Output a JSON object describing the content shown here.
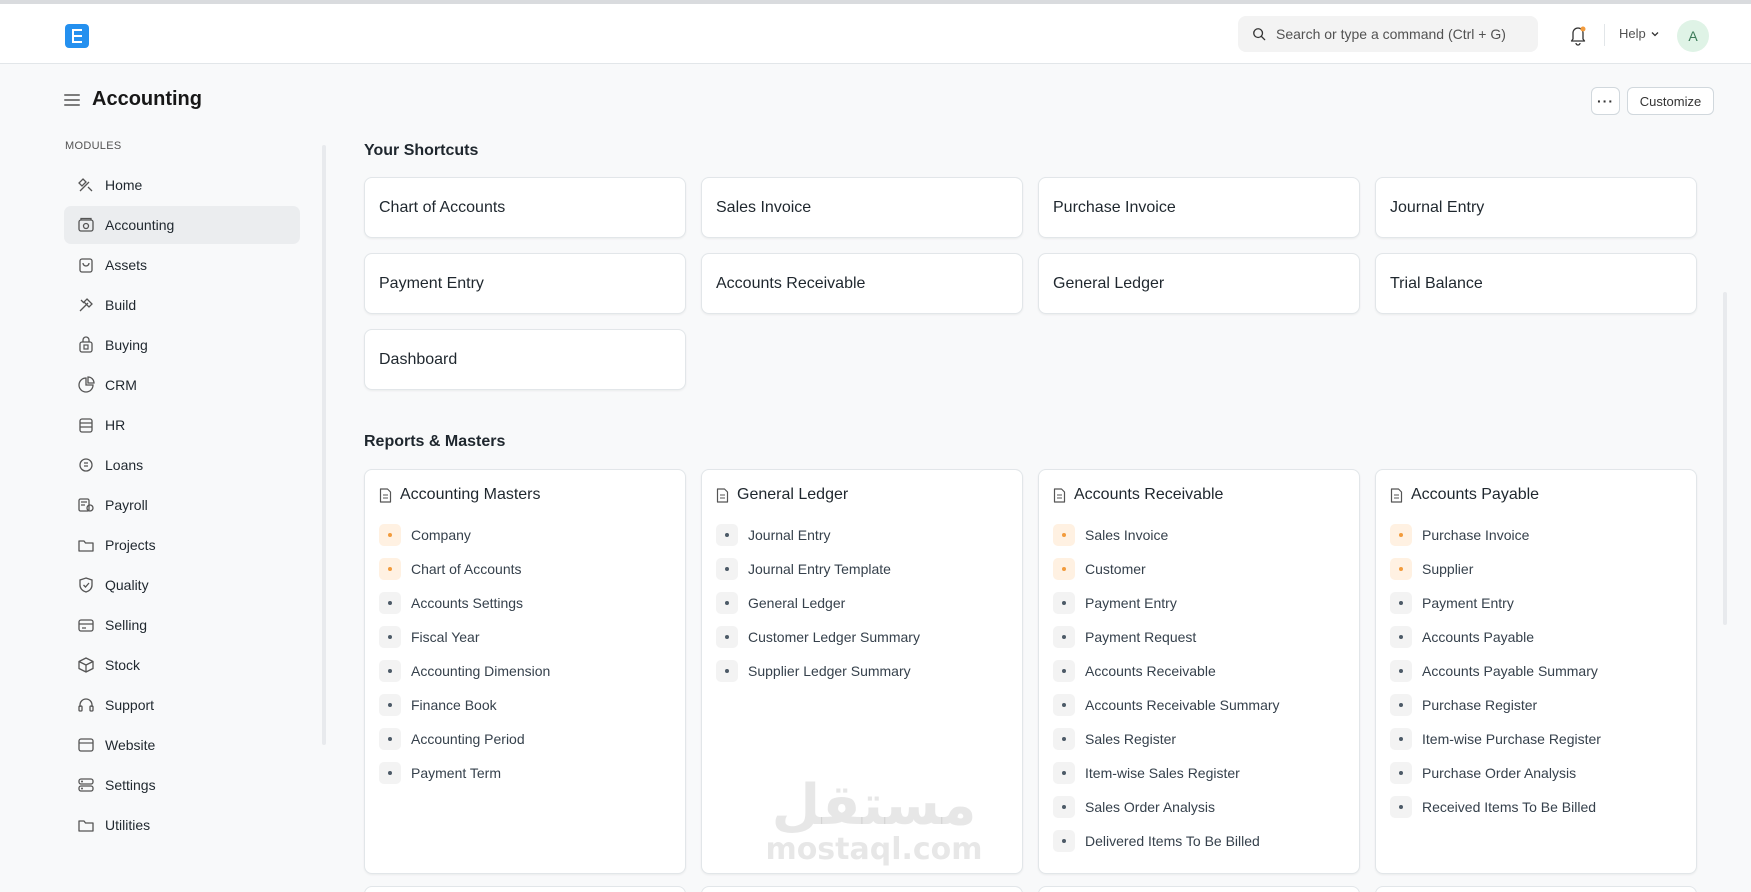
{
  "navbar": {
    "search_placeholder": "Search or type a command (Ctrl + G)",
    "help_label": "Help",
    "avatar_initial": "A"
  },
  "page": {
    "title": "Accounting",
    "more_label": "···",
    "customize_label": "Customize"
  },
  "sidebar": {
    "section_label": "MODULES",
    "items": [
      {
        "label": "Home",
        "icon": "home-icon"
      },
      {
        "label": "Accounting",
        "icon": "accounting-icon",
        "active": true
      },
      {
        "label": "Assets",
        "icon": "assets-icon"
      },
      {
        "label": "Build",
        "icon": "build-icon"
      },
      {
        "label": "Buying",
        "icon": "buying-icon"
      },
      {
        "label": "CRM",
        "icon": "crm-icon"
      },
      {
        "label": "HR",
        "icon": "hr-icon"
      },
      {
        "label": "Loans",
        "icon": "loans-icon"
      },
      {
        "label": "Payroll",
        "icon": "payroll-icon"
      },
      {
        "label": "Projects",
        "icon": "projects-icon"
      },
      {
        "label": "Quality",
        "icon": "quality-icon"
      },
      {
        "label": "Selling",
        "icon": "selling-icon"
      },
      {
        "label": "Stock",
        "icon": "stock-icon"
      },
      {
        "label": "Support",
        "icon": "support-icon"
      },
      {
        "label": "Website",
        "icon": "website-icon"
      },
      {
        "label": "Settings",
        "icon": "settings-icon"
      },
      {
        "label": "Utilities",
        "icon": "utilities-icon"
      }
    ]
  },
  "shortcuts": {
    "title": "Your Shortcuts",
    "items": [
      "Chart of Accounts",
      "Sales Invoice",
      "Purchase Invoice",
      "Journal Entry",
      "Payment Entry",
      "Accounts Receivable",
      "General Ledger",
      "Trial Balance",
      "Dashboard"
    ]
  },
  "reports": {
    "title": "Reports & Masters",
    "cards": [
      {
        "title": "Accounting Masters",
        "links": [
          {
            "label": "Company",
            "highlight": true
          },
          {
            "label": "Chart of Accounts",
            "highlight": true
          },
          {
            "label": "Accounts Settings"
          },
          {
            "label": "Fiscal Year"
          },
          {
            "label": "Accounting Dimension"
          },
          {
            "label": "Finance Book"
          },
          {
            "label": "Accounting Period"
          },
          {
            "label": "Payment Term"
          }
        ]
      },
      {
        "title": "General Ledger",
        "links": [
          {
            "label": "Journal Entry"
          },
          {
            "label": "Journal Entry Template"
          },
          {
            "label": "General Ledger"
          },
          {
            "label": "Customer Ledger Summary"
          },
          {
            "label": "Supplier Ledger Summary"
          }
        ]
      },
      {
        "title": "Accounts Receivable",
        "links": [
          {
            "label": "Sales Invoice",
            "highlight": true
          },
          {
            "label": "Customer",
            "highlight": true
          },
          {
            "label": "Payment Entry"
          },
          {
            "label": "Payment Request"
          },
          {
            "label": "Accounts Receivable"
          },
          {
            "label": "Accounts Receivable Summary"
          },
          {
            "label": "Sales Register"
          },
          {
            "label": "Item-wise Sales Register"
          },
          {
            "label": "Sales Order Analysis"
          },
          {
            "label": "Delivered Items To Be Billed"
          }
        ]
      },
      {
        "title": "Accounts Payable",
        "links": [
          {
            "label": "Purchase Invoice",
            "highlight": true
          },
          {
            "label": "Supplier",
            "highlight": true
          },
          {
            "label": "Payment Entry"
          },
          {
            "label": "Accounts Payable"
          },
          {
            "label": "Accounts Payable Summary"
          },
          {
            "label": "Purchase Register"
          },
          {
            "label": "Item-wise Purchase Register"
          },
          {
            "label": "Purchase Order Analysis"
          },
          {
            "label": "Received Items To Be Billed"
          }
        ]
      }
    ]
  },
  "watermark": {
    "arabic": "مستقل",
    "latin": "mostaql.com"
  },
  "colors": {
    "brand": "#2490ef",
    "highlight_dot": "#f29b3c",
    "active_bg": "#ebedef"
  }
}
